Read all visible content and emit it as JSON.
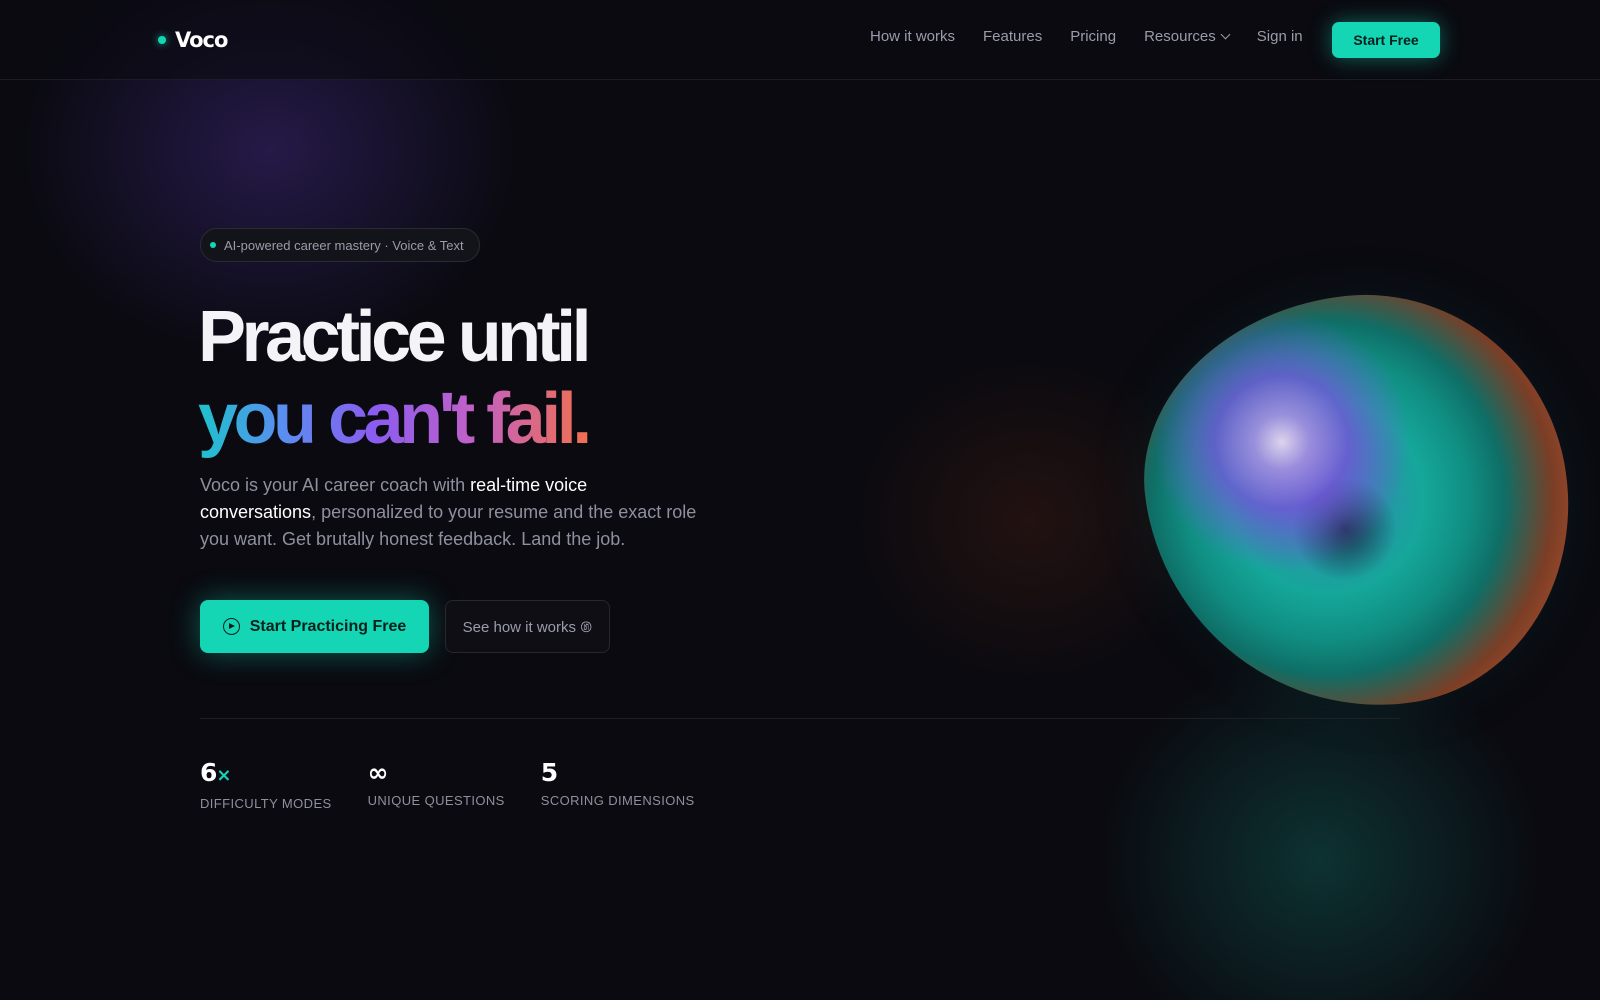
{
  "nav": {
    "logo": "Voco",
    "links": [
      "How it works",
      "Features",
      "Pricing"
    ],
    "resources_label": "Resources",
    "signin_label": "Sign in",
    "cta_label": "Start Free"
  },
  "hero": {
    "pill": "AI-powered career mastery · Voice & Text",
    "headline_line1": "Practice until",
    "headline_line2": "you can't fail.",
    "description": {
      "part1": "Voco is your AI career coach with ",
      "highlight": "real-time voice conversations",
      "part2": ", personalized to your resume and the exact role you want. Get brutally honest feedback. Land the job."
    },
    "primary_cta": "Start Practicing Free",
    "secondary_cta": "See how it works 𞅏"
  },
  "stats": [
    {
      "value": "6",
      "accent": "×",
      "label": "Difficulty Modes"
    },
    {
      "value": "∞",
      "accent": "",
      "label": "Unique Questions"
    },
    {
      "value": "5",
      "accent": "",
      "label": "Scoring Dimensions"
    }
  ],
  "colors": {
    "accent": "#14d6b4",
    "background": "#0a0a10",
    "gradient_start": "#1ec2cc",
    "gradient_end": "#f07050"
  },
  "icons": {
    "logo": "logo-dot-icon",
    "resources": "chevron-down-icon",
    "primary_cta": "play-circle-icon"
  }
}
